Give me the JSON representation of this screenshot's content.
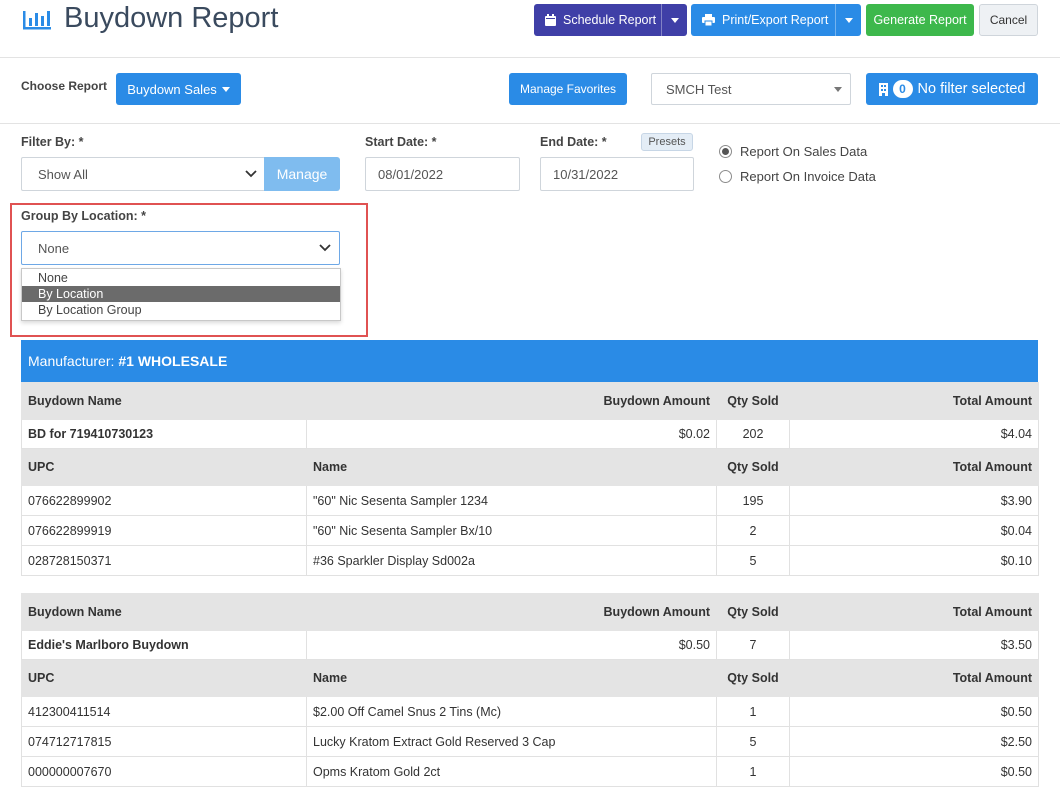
{
  "header": {
    "title": "Buydown Report",
    "schedule_label": "Schedule Report",
    "print_label": "Print/Export Report",
    "generate_label": "Generate Report",
    "cancel_label": "Cancel"
  },
  "toolbar": {
    "choose_report_label": "Choose Report",
    "report_type": "Buydown Sales",
    "manage_favorites_label": "Manage Favorites",
    "store_select": "SMCH Test",
    "filter_count": "0",
    "filter_label": "No filter selected"
  },
  "filters": {
    "filter_by_label": "Filter By: *",
    "filter_by_value": "Show All",
    "manage_label": "Manage",
    "start_date_label": "Start Date: *",
    "start_date": "08/01/2022",
    "end_date_label": "End Date: *",
    "end_date": "10/31/2022",
    "presets_label": "Presets",
    "radio_sales": "Report On Sales Data",
    "radio_invoice": "Report On Invoice Data",
    "group_by_label": "Group By Location: *",
    "group_by_value": "None",
    "group_by_options": [
      "None",
      "By Location",
      "By Location Group"
    ]
  },
  "report": {
    "manufacturer_prefix": "Manufacturer:",
    "manufacturer_name": "#1 WHOLESALE",
    "col_buydown_name": "Buydown Name",
    "col_buydown_amount": "Buydown Amount",
    "col_qty_sold": "Qty Sold",
    "col_total_amount": "Total Amount",
    "col_upc": "UPC",
    "col_name": "Name",
    "groups": [
      {
        "buydown_name": "BD for 719410730123",
        "buydown_amount": "$0.02",
        "qty_sold": "202",
        "total_amount": "$4.04",
        "items": [
          {
            "upc": "076622899902",
            "name": "\"60\" Nic Sesenta Sampler 1234",
            "qty": "195",
            "total": "$3.90"
          },
          {
            "upc": "076622899919",
            "name": "\"60\" Nic Sesenta Sampler Bx/10",
            "qty": "2",
            "total": "$0.04"
          },
          {
            "upc": "028728150371",
            "name": "#36 Sparkler Display Sd002a",
            "qty": "5",
            "total": "$0.10"
          }
        ]
      },
      {
        "buydown_name": "Eddie's Marlboro Buydown",
        "buydown_amount": "$0.50",
        "qty_sold": "7",
        "total_amount": "$3.50",
        "items": [
          {
            "upc": "412300411514",
            "name": "$2.00 Off Camel Snus 2 Tins (Mc)",
            "qty": "1",
            "total": "$0.50"
          },
          {
            "upc": "074712717815",
            "name": "Lucky Kratom Extract Gold Reserved 3 Cap",
            "qty": "5",
            "total": "$2.50"
          },
          {
            "upc": "000000007670",
            "name": "Opms Kratom Gold 2ct",
            "qty": "1",
            "total": "$0.50"
          }
        ]
      }
    ]
  },
  "colors": {
    "primary_blue": "#2a8be6",
    "purple": "#3f3fa7",
    "green": "#3db84c",
    "highlight_red": "#e05252"
  }
}
